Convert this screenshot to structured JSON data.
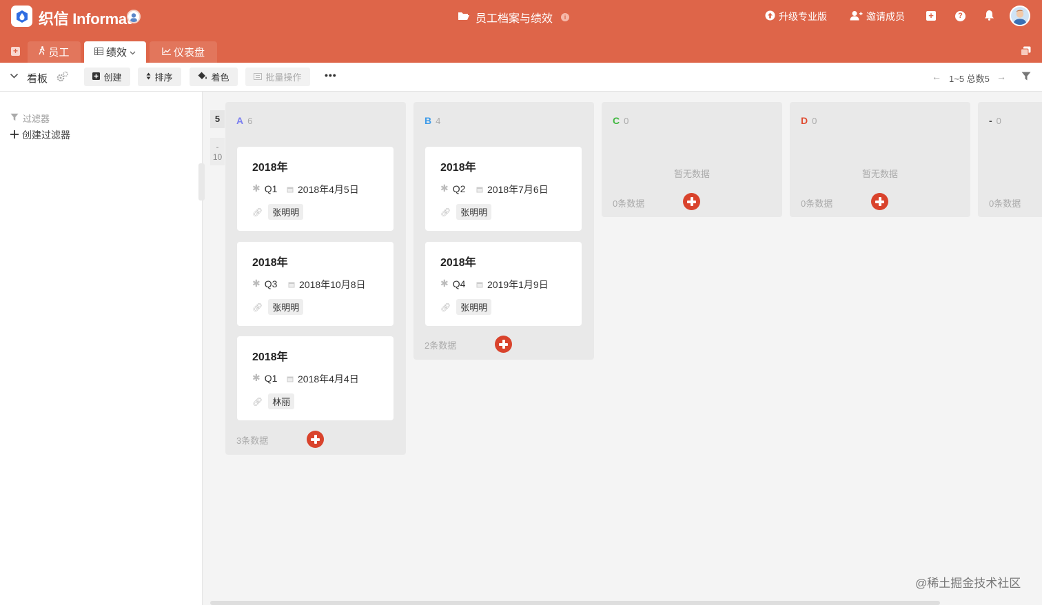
{
  "app": {
    "brand": "织信 Informat",
    "doc_title": "员工档案与绩效",
    "actions": {
      "upgrade": "升级专业版",
      "invite": "邀请成员"
    }
  },
  "tabs": [
    {
      "label": "员工",
      "icon": "person-walk-icon"
    },
    {
      "label": "绩效",
      "icon": "table-icon"
    },
    {
      "label": "仪表盘",
      "icon": "line-chart-icon"
    }
  ],
  "toolbar": {
    "view_name": "看板",
    "create": "创建",
    "sort": "排序",
    "color": "着色",
    "batch": "批量操作",
    "more": "•••",
    "pagination": "1~5 总数5"
  },
  "sidebar": {
    "filter_title": "过滤器",
    "create_filter": "创建过滤器"
  },
  "board": {
    "row_label": "5",
    "row_label2_top": "-",
    "row_label2_bottom": "10",
    "empty_text": "暂无数据",
    "columns": [
      {
        "level": "A",
        "count": "6",
        "color": "#7b7ff0",
        "footer": "3条数据",
        "cards": [
          {
            "title": "2018年",
            "quarter": "Q1",
            "date": "2018年4月5日",
            "person": "张明明"
          },
          {
            "title": "2018年",
            "quarter": "Q3",
            "date": "2018年10月8日",
            "person": "张明明"
          },
          {
            "title": "2018年",
            "quarter": "Q1",
            "date": "2018年4月4日",
            "person": "林丽"
          }
        ]
      },
      {
        "level": "B",
        "count": "4",
        "color": "#3d9be9",
        "footer": "2条数据",
        "cards": [
          {
            "title": "2018年",
            "quarter": "Q2",
            "date": "2018年7月6日",
            "person": "张明明"
          },
          {
            "title": "2018年",
            "quarter": "Q4",
            "date": "2019年1月9日",
            "person": "张明明"
          }
        ]
      },
      {
        "level": "C",
        "count": "0",
        "color": "#3fb83f",
        "footer": "0条数据"
      },
      {
        "level": "D",
        "count": "0",
        "color": "#e04a2f",
        "footer": "0条数据"
      },
      {
        "level": "-",
        "count": "0",
        "color": "#444444",
        "footer": "0条数据"
      }
    ]
  },
  "watermark": "@稀土掘金技术社区",
  "colors": {
    "brand": "#de6549",
    "add": "#d9432c"
  }
}
